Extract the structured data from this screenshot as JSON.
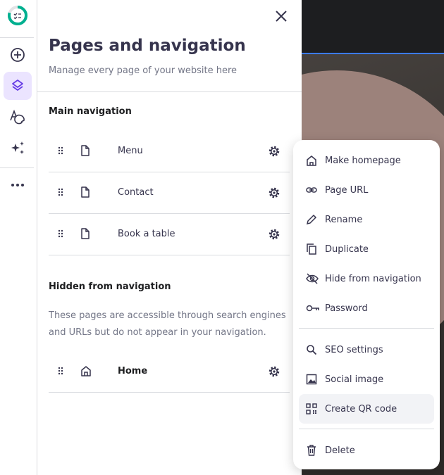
{
  "panel": {
    "title": "Pages and navigation",
    "subtitle": "Manage every page of your website here"
  },
  "main_nav": {
    "heading": "Main navigation",
    "items": [
      {
        "label": "Menu"
      },
      {
        "label": "Contact"
      },
      {
        "label": "Book a table"
      }
    ]
  },
  "hidden_nav": {
    "heading": "Hidden from navigation",
    "description": "These pages are accessible through search engines and URLs but do not appear in your navigation.",
    "items": [
      {
        "label": "Home"
      }
    ]
  },
  "context_menu": {
    "items": [
      {
        "label": "Make homepage",
        "icon": "home-icon"
      },
      {
        "label": "Page URL",
        "icon": "link-icon"
      },
      {
        "label": "Rename",
        "icon": "pencil-icon"
      },
      {
        "label": "Duplicate",
        "icon": "duplicate-icon"
      },
      {
        "label": "Hide from navigation",
        "icon": "eye-off-icon"
      },
      {
        "label": "Password",
        "icon": "key-icon"
      },
      {
        "label": "SEO settings",
        "icon": "search-icon"
      },
      {
        "label": "Social image",
        "icon": "image-icon"
      },
      {
        "label": "Create QR code",
        "icon": "qr-code-icon"
      },
      {
        "label": "Delete",
        "icon": "trash-icon"
      }
    ]
  },
  "colors": {
    "accent": "#673de6",
    "progress": "#00b090"
  }
}
